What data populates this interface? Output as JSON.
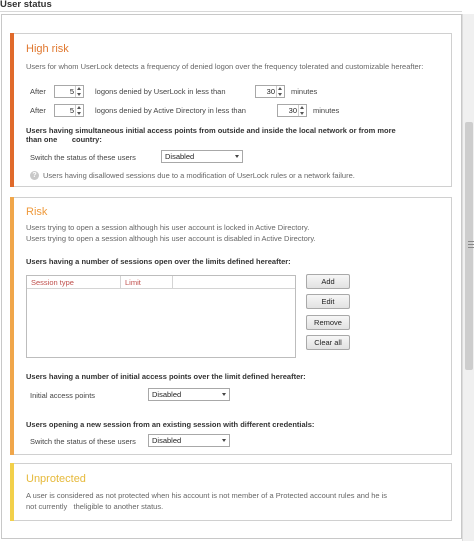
{
  "page": {
    "title": "User status"
  },
  "high_risk": {
    "title": "High risk",
    "color": "#e06a2b",
    "description": "Users for whom UserLock detects a frequency of denied logon over the frequency tolerated and customizable hereafter:",
    "row1": {
      "after": "After",
      "count": "5",
      "label": "logons denied by UserLock in less than",
      "minutes": "30",
      "unit": "minutes"
    },
    "row2": {
      "after": "After",
      "count": "5",
      "label": "logons denied by Active Directory in less than",
      "minutes": "30",
      "unit": "minutes"
    },
    "simultaneous_line1": "Users having simultaneous initial access points from outside and inside the local network or from more",
    "simultaneous_line2": "than one       country:",
    "switch_label": "Switch the status of these users",
    "switch_value": "Disabled",
    "info_text": "Users having disallowed sessions due to a modification of UserLock rules or a network failure."
  },
  "risk": {
    "title": "Risk",
    "color": "#f0a64a",
    "line1": "Users trying to open a session although his user account is locked in Active Directory.",
    "line2": "Users trying to open a session although his user account is disabled in Active Directory.",
    "sessions_heading": "Users having a number of sessions open over the limits defined hereafter:",
    "columns": [
      "Session type",
      "Limit"
    ],
    "buttons": {
      "add": "Add",
      "edit": "Edit",
      "remove": "Remove",
      "clear": "Clear all"
    },
    "access_heading": "Users having a number of initial access points over the limit defined hereafter:",
    "access_label": "Initial access points",
    "access_value": "Disabled",
    "credentials_heading": "Users opening a new session from an existing session with different credentials:",
    "credentials_label": "Switch the status of these users",
    "credentials_value": "Disabled"
  },
  "unprotected": {
    "title": "Unprotected",
    "color": "#f2d04a",
    "line1": "A user is considered as not protected when his account is not member of a Protected account rules and he is",
    "line2": "not currently   theligible to another status."
  },
  "colors": {
    "high_title": "#e0782f",
    "risk_title": "#ef9a3c",
    "unprotected_title": "#e6b93a",
    "header_red": "#c0504d"
  }
}
